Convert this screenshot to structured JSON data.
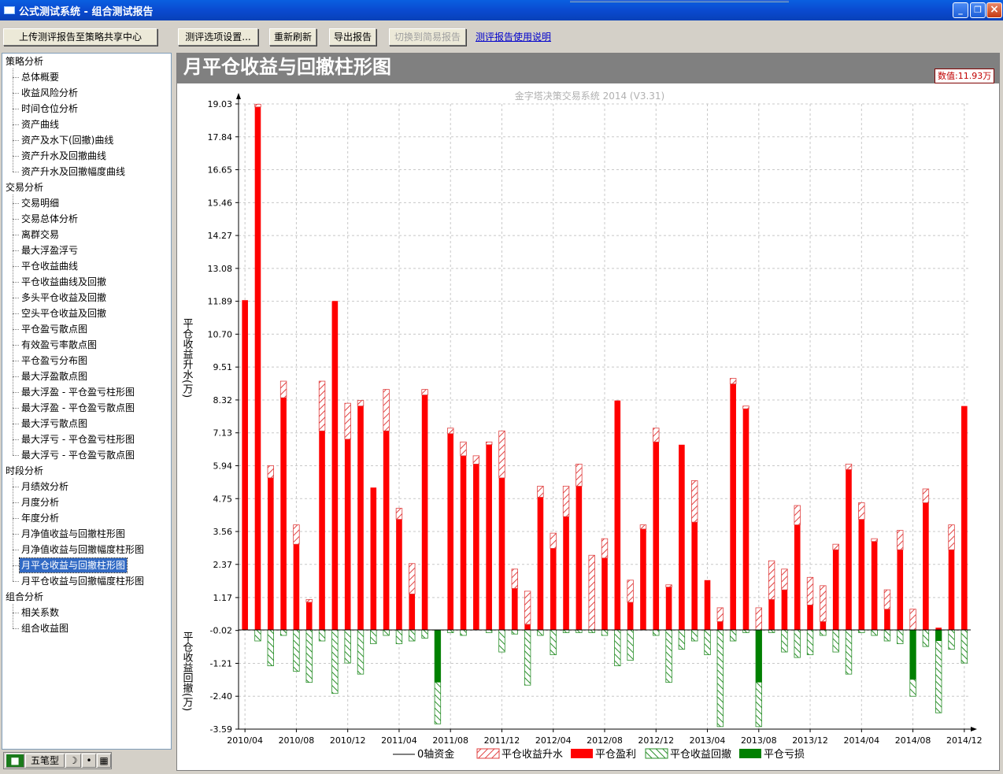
{
  "window": {
    "title": "公式测试系统 - 组合测试报告",
    "minimize": "_",
    "maximize": "❐",
    "close": "×"
  },
  "toolbar": {
    "upload_label": "上传测评报告至策略共享中心",
    "options_label": "测评选项设置...",
    "refresh_label": "重新刷新",
    "export_label": "导出报告",
    "switch_label": "切换到简易报告",
    "help_label": "测评报告使用说明"
  },
  "tree": [
    {
      "label": "策略分析",
      "items": [
        "总体概要",
        "收益风险分析",
        "时间仓位分析",
        "资产曲线",
        "资产及水下(回撤)曲线",
        "资产升水及回撤曲线",
        "资产升水及回撤幅度曲线"
      ]
    },
    {
      "label": "交易分析",
      "items": [
        "交易明细",
        "交易总体分析",
        "离群交易",
        "最大浮盈浮亏",
        "平仓收益曲线",
        "平仓收益曲线及回撤",
        "多头平仓收益及回撤",
        "空头平仓收益及回撤",
        "平仓盈亏散点图",
        "有效盈亏率散点图",
        "平仓盈亏分布图",
        "最大浮盈散点图",
        "最大浮盈 - 平仓盈亏柱形图",
        "最大浮盈 - 平仓盈亏散点图",
        "最大浮亏散点图",
        "最大浮亏 - 平仓盈亏柱形图",
        "最大浮亏 - 平仓盈亏散点图"
      ]
    },
    {
      "label": "时段分析",
      "items": [
        "月绩效分析",
        "月度分析",
        "年度分析",
        "月净值收益与回撤柱形图",
        "月净值收益与回撤幅度柱形图",
        "月平仓收益与回撤柱形图",
        "月平仓收益与回撤幅度柱形图"
      ]
    },
    {
      "label": "组合分析",
      "items": [
        "相关系数",
        "组合收益图"
      ]
    }
  ],
  "selected_item": "月平仓收益与回撤柱形图",
  "ime": {
    "label": "五笔型"
  },
  "chart_header": {
    "title": "月平仓收益与回撤柱形图",
    "value_box": "数值:11.93万"
  },
  "chart_data": {
    "type": "bar",
    "watermark": "金字塔决策交易系统 2014 (V3.31)",
    "ylabel_top": "平仓收益升水(万)",
    "ylabel_bottom": "平仓收益回撤(万)",
    "yticks": [
      "19.03",
      "17.84",
      "16.65",
      "15.46",
      "14.27",
      "13.08",
      "11.89",
      "10.70",
      "9.51",
      "8.32",
      "7.13",
      "5.94",
      "4.75",
      "3.56",
      "2.37",
      "1.17",
      "-0.02",
      "-1.21",
      "-2.40",
      "-3.59"
    ],
    "ylim": [
      -3.59,
      19.03
    ],
    "xticks": [
      "2010/04",
      "2010/08",
      "2010/12",
      "2011/04",
      "2011/08",
      "2011/12",
      "2012/04",
      "2012/08",
      "2012/12",
      "2013/04",
      "2013/08",
      "2013/12",
      "2014/04",
      "2014/08",
      "2014/12"
    ],
    "legend": [
      "0轴资金",
      "平仓收益升水",
      "平仓盈利",
      "平仓收益回撤",
      "平仓亏损"
    ],
    "colors": {
      "profit": "#ff0000",
      "loss": "#008000",
      "upwater_hatch": "#e04040",
      "drawdown_hatch": "#2a8f2a",
      "grid": "#c8c8c8"
    },
    "months": [
      {
        "profit": 11.93,
        "up": 0,
        "dd": 0
      },
      {
        "profit": 18.92,
        "up": 0.1,
        "dd": -0.4
      },
      {
        "profit": 5.5,
        "up": 0.44,
        "dd": -1.3
      },
      {
        "profit": 8.4,
        "up": 0.6,
        "dd": -0.2
      },
      {
        "profit": 3.1,
        "up": 0.7,
        "dd": -1.5
      },
      {
        "profit": 1.0,
        "up": 0.1,
        "dd": -1.9
      },
      {
        "profit": 7.2,
        "up": 1.8,
        "dd": -0.4
      },
      {
        "profit": 11.9,
        "up": 0,
        "dd": -2.3
      },
      {
        "profit": 6.9,
        "up": 1.3,
        "dd": -1.2
      },
      {
        "profit": 8.1,
        "up": 0.2,
        "dd": -1.6
      },
      {
        "profit": 5.15,
        "up": 0,
        "dd": -0.5
      },
      {
        "profit": 7.2,
        "up": 1.5,
        "dd": -0.2
      },
      {
        "profit": 4.0,
        "up": 0.4,
        "dd": -0.5
      },
      {
        "profit": 1.3,
        "up": 1.1,
        "dd": -0.4
      },
      {
        "profit": 8.5,
        "up": 0.2,
        "dd": -0.3
      },
      {
        "profit": 0,
        "up": 0,
        "dd": -3.4,
        "loss": -1.9
      },
      {
        "profit": 7.1,
        "up": 0.2,
        "dd": -0.1
      },
      {
        "profit": 6.3,
        "up": 0.5,
        "dd": -0.2
      },
      {
        "profit": 6.0,
        "up": 0.3,
        "dd": 0
      },
      {
        "profit": 6.7,
        "up": 0.1,
        "dd": -0.1
      },
      {
        "profit": 5.5,
        "up": 1.7,
        "dd": -0.8
      },
      {
        "profit": 1.5,
        "up": 0.7,
        "dd": -0.15
      },
      {
        "profit": 0.2,
        "up": 1.2,
        "dd": -2.0
      },
      {
        "profit": 4.8,
        "up": 0.4,
        "dd": -0.2
      },
      {
        "profit": 2.95,
        "up": 0.55,
        "dd": -0.9
      },
      {
        "profit": 4.1,
        "up": 1.1,
        "dd": -0.1
      },
      {
        "profit": 5.2,
        "up": 0.8,
        "dd": -0.1
      },
      {
        "profit": 0,
        "up": 2.7,
        "dd": -0.1
      },
      {
        "profit": 2.6,
        "up": 0.7,
        "dd": -0.2
      },
      {
        "profit": 8.3,
        "up": 0,
        "dd": -1.3
      },
      {
        "profit": 1.0,
        "up": 0.8,
        "dd": -1.1
      },
      {
        "profit": 3.65,
        "up": 0.15,
        "dd": 0
      },
      {
        "profit": 6.8,
        "up": 0.5,
        "dd": -0.2
      },
      {
        "profit": 1.55,
        "up": 0.08,
        "dd": -1.9
      },
      {
        "profit": 6.7,
        "up": 0,
        "dd": -0.7
      },
      {
        "profit": 3.9,
        "up": 1.5,
        "dd": -0.4
      },
      {
        "profit": 1.8,
        "up": 0,
        "dd": -0.9
      },
      {
        "profit": 0.3,
        "up": 0.5,
        "dd": -3.5
      },
      {
        "profit": 8.9,
        "up": 0.2,
        "dd": -0.4
      },
      {
        "profit": 8.0,
        "up": 0.1,
        "dd": -0.1
      },
      {
        "profit": 0,
        "up": 0.8,
        "dd": -3.5,
        "loss": -1.9
      },
      {
        "profit": 1.1,
        "up": 1.4,
        "dd": -0.1
      },
      {
        "profit": 1.45,
        "up": 0.75,
        "dd": -0.8
      },
      {
        "profit": 3.8,
        "up": 0.7,
        "dd": -1.0
      },
      {
        "profit": 0.9,
        "up": 1.0,
        "dd": -0.9
      },
      {
        "profit": 0.3,
        "up": 1.3,
        "dd": -0.2
      },
      {
        "profit": 2.9,
        "up": 0.2,
        "dd": -0.8
      },
      {
        "profit": 5.8,
        "up": 0.2,
        "dd": -1.6
      },
      {
        "profit": 4.0,
        "up": 0.6,
        "dd": -0.1
      },
      {
        "profit": 3.2,
        "up": 0.1,
        "dd": -0.2
      },
      {
        "profit": 0.75,
        "up": 0.7,
        "dd": -0.4
      },
      {
        "profit": 2.9,
        "up": 0.7,
        "dd": -0.5
      },
      {
        "profit": 0,
        "up": 0.75,
        "dd": -2.4,
        "loss": -1.8
      },
      {
        "profit": 4.6,
        "up": 0.5,
        "dd": -0.6
      },
      {
        "profit": 0.08,
        "up": 0,
        "dd": -3.0,
        "loss": -0.4
      },
      {
        "profit": 2.9,
        "up": 0.9,
        "dd": -0.7
      },
      {
        "profit": 8.1,
        "up": 0,
        "dd": -1.2
      }
    ]
  }
}
